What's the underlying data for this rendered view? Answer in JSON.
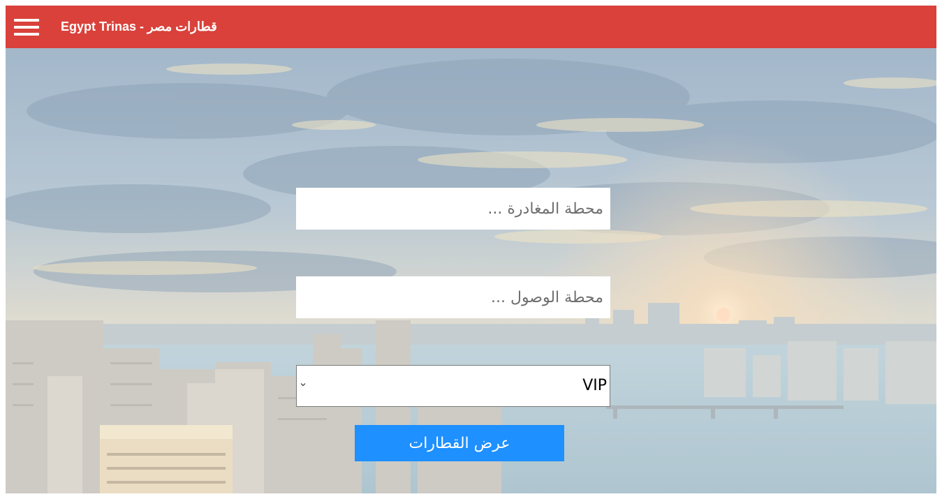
{
  "header": {
    "menu_icon": "hamburger-menu-icon",
    "brand": "Egypt Trinas - قطارات مصر",
    "background_color": "#d9413a"
  },
  "hero": {
    "background_image": "cairo-nile-skyline-photo"
  },
  "form": {
    "departure_placeholder": "محطة المغادرة ...",
    "arrival_placeholder": "محطة الوصول ...",
    "class_selected": "VIP",
    "class_dropdown_icon": "chevron-down-icon",
    "submit_label": "عرض القطارات",
    "submit_color": "#1e90ff"
  }
}
